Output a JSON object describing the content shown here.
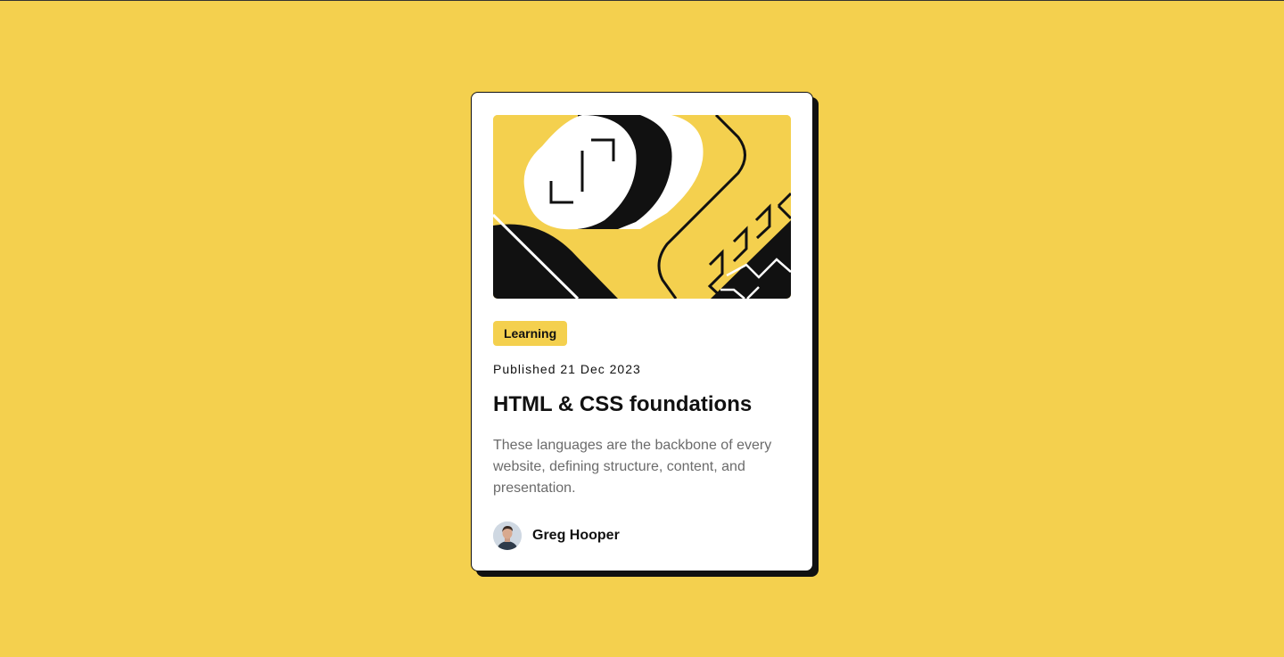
{
  "colors": {
    "background": "#f4d04e",
    "card": "#ffffff",
    "ink": "#111111",
    "muted": "#6b6b6b"
  },
  "card": {
    "hero_image": "abstract-yellow-black-illustration",
    "tag": "Learning",
    "published": "Published 21 Dec 2023",
    "title": "HTML & CSS foundations",
    "description": "These languages are the backbone of every website, defining structure, content, and presentation.",
    "author": {
      "avatar": "author-avatar",
      "name": "Greg Hooper"
    }
  }
}
